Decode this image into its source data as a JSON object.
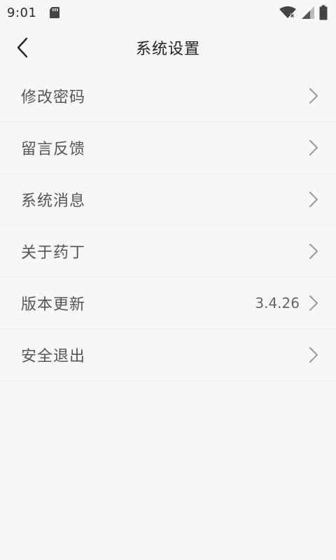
{
  "status_bar": {
    "time": "9:01",
    "icons": [
      "sd-card-icon",
      "wifi-icon",
      "signal-icon",
      "battery-icon"
    ]
  },
  "header": {
    "title": "系统设置",
    "back_icon": "chevron-left-icon"
  },
  "settings": {
    "items": [
      {
        "label": "修改密码",
        "value": ""
      },
      {
        "label": "留言反馈",
        "value": ""
      },
      {
        "label": "系统消息",
        "value": ""
      },
      {
        "label": "关于药丁",
        "value": ""
      },
      {
        "label": "版本更新",
        "value": "3.4.26"
      },
      {
        "label": "安全退出",
        "value": ""
      }
    ]
  },
  "colors": {
    "background": "#f7f7f7",
    "divider": "#ececec",
    "label_text": "#555555",
    "title_text": "#222222",
    "chevron": "#9a9a9a"
  }
}
